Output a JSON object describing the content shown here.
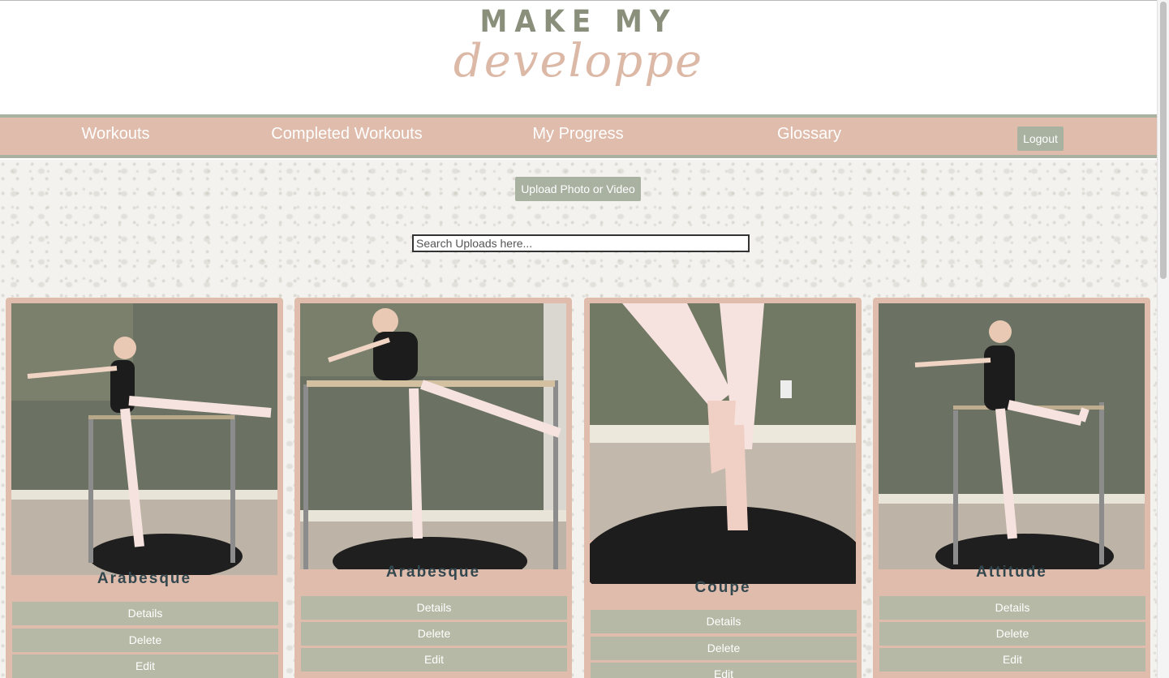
{
  "logo": {
    "line1": "MAKE MY",
    "line2": "developpe"
  },
  "nav": {
    "items": [
      "Workouts",
      "Completed Workouts",
      "My Progress",
      "Glossary"
    ],
    "logout_label": "Logout"
  },
  "upload_label": "Upload Photo or Video",
  "search": {
    "placeholder": "Search Uploads here...",
    "value": ""
  },
  "cards": [
    {
      "name": "Arabesque",
      "details_label": "Details",
      "delete_label": "Delete",
      "edit_label": "Edit"
    },
    {
      "name": "Arabesque",
      "details_label": "Details",
      "delete_label": "Delete",
      "edit_label": "Edit"
    },
    {
      "name": "Coupe",
      "details_label": "Details",
      "delete_label": "Delete",
      "edit_label": "Edit"
    },
    {
      "name": "Attitude",
      "details_label": "Details",
      "delete_label": "Delete",
      "edit_label": "Edit"
    }
  ],
  "colors": {
    "nav_bg": "#dfbcab",
    "accent_green": "#a9b1a1",
    "card_bg": "#dfbcab",
    "card_button": "#b5b9a5",
    "title_text": "#33474f"
  }
}
